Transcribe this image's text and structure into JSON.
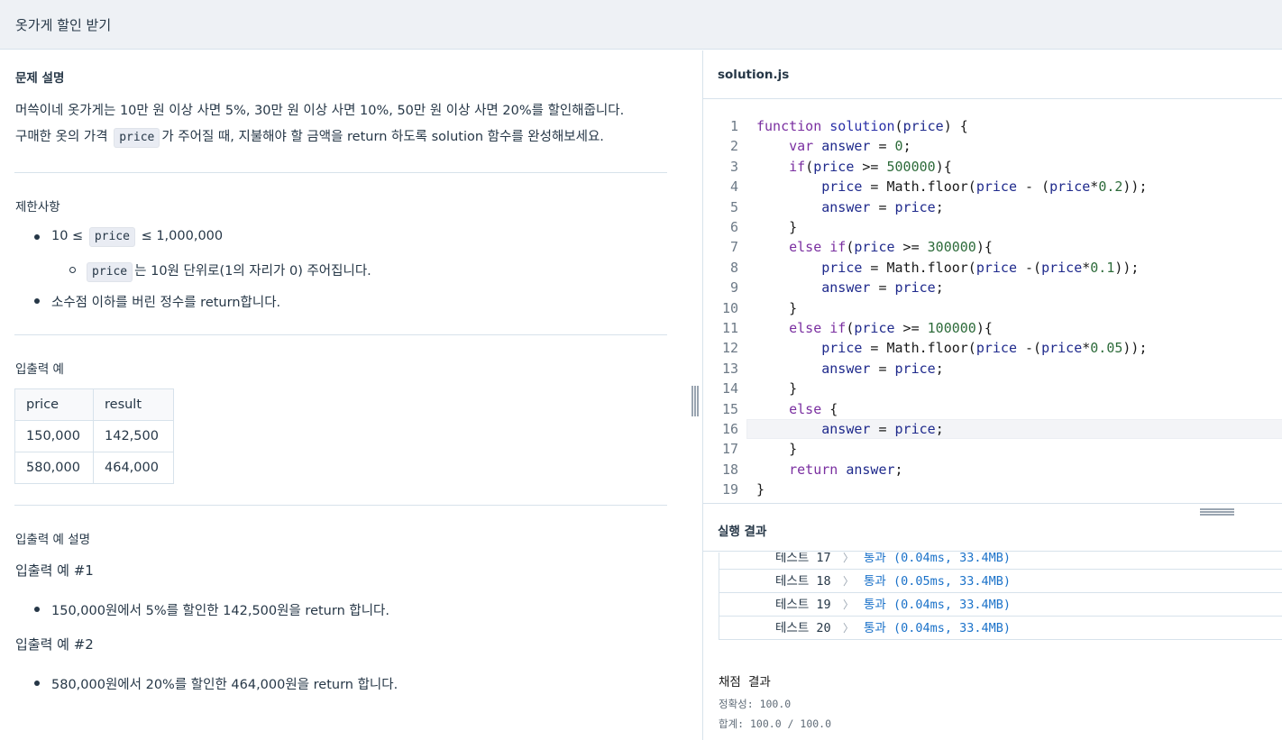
{
  "page": {
    "title": "옷가게 할인 받기"
  },
  "problem": {
    "heading": "문제 설명",
    "line1": "머쓱이네 옷가게는 10만 원 이상 사면 5%, 30만 원 이상 사면 10%, 50만 원 이상 사면 20%를 할인해줍니다.",
    "line2_prefix": "구매한 옷의 가격",
    "line2_code": "price",
    "line2_suffix": "가 주어질 때, 지불해야 할 금액을 return 하도록 solution 함수를 완성해보세요."
  },
  "constraints": {
    "heading": "제한사항",
    "item1_prefix": "10 ≤",
    "item1_code": "price",
    "item1_suffix": "≤ 1,000,000",
    "sub1_code": "price",
    "sub1_text": "는 10원 단위로(1의 자리가 0) 주어집니다.",
    "item2": "소수점 이하를 버린 정수를 return합니다."
  },
  "io_example": {
    "heading": "입출력 예",
    "columns": [
      "price",
      "result"
    ],
    "rows": [
      [
        "150,000",
        "142,500"
      ],
      [
        "580,000",
        "464,000"
      ]
    ]
  },
  "io_explanation": {
    "heading": "입출력 예 설명",
    "ex1_title": "입출력 예 #1",
    "ex1_item": "150,000원에서 5%를 할인한 142,500원을 return 합니다.",
    "ex2_title": "입출력 예 #2",
    "ex2_item": "580,000원에서 20%를 할인한 464,000원을 return 합니다."
  },
  "editor": {
    "filename": "solution.js",
    "active_line": 16,
    "lines": [
      "function solution(price) {",
      "    var answer = 0;",
      "    if(price >= 500000){",
      "        price = Math.floor(price - (price*0.2));",
      "        answer = price;",
      "    }",
      "    else if(price >= 300000){",
      "        price = Math.floor(price -(price*0.1));",
      "        answer = price;",
      "    }",
      "    else if(price >= 100000){",
      "        price = Math.floor(price -(price*0.05));",
      "        answer = price;",
      "    }",
      "    else {",
      "        answer = price;",
      "    }",
      "    return answer;",
      "}"
    ]
  },
  "results": {
    "heading": "실행 결과",
    "tests": [
      {
        "label": "테스트 17",
        "result": "통과 (0.04ms, 33.4MB)"
      },
      {
        "label": "테스트 18",
        "result": "통과 (0.05ms, 33.4MB)"
      },
      {
        "label": "테스트 19",
        "result": "통과 (0.04ms, 33.4MB)"
      },
      {
        "label": "테스트 20",
        "result": "통과 (0.04ms, 33.4MB)"
      }
    ],
    "grade_title": "채점 결과",
    "accuracy": "정확성: 100.0",
    "total": "합계: 100.0 / 100.0"
  }
}
